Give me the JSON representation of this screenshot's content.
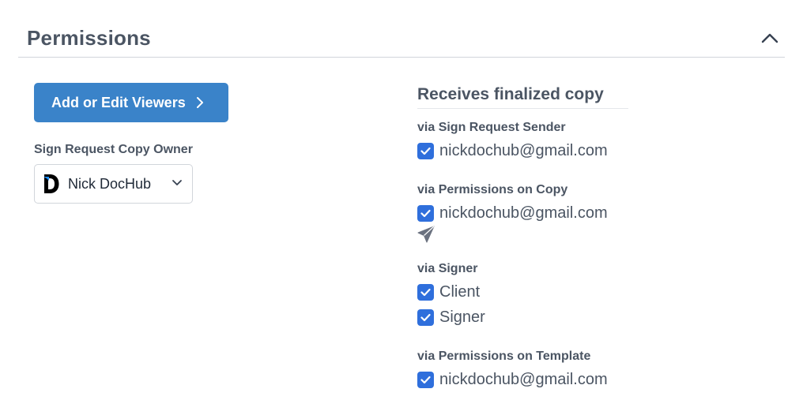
{
  "section": {
    "title": "Permissions",
    "collapse_icon": "chevron-up-icon"
  },
  "viewers": {
    "button_label": "Add or Edit Viewers",
    "button_icon": "chevron-right-icon"
  },
  "owner": {
    "label": "Sign Request Copy Owner",
    "selected": "Nick DocHub",
    "logo_icon": "dochub-logo-icon",
    "dropdown_icon": "chevron-down-icon"
  },
  "finalized": {
    "title": "Receives finalized copy",
    "groups": [
      {
        "label": "via Sign Request Sender",
        "items": [
          {
            "text": "nickdochub@gmail.com",
            "checked": true
          }
        ]
      },
      {
        "label": "via Permissions on Copy",
        "items": [
          {
            "text": "nickdochub@gmail.com",
            "checked": true
          }
        ],
        "action_icon": "send-icon"
      },
      {
        "label": "via Signer",
        "items": [
          {
            "text": "Client",
            "checked": true
          },
          {
            "text": "Signer",
            "checked": true
          }
        ]
      },
      {
        "label": "via Permissions on Template",
        "items": [
          {
            "text": "nickdochub@gmail.com",
            "checked": true
          }
        ]
      }
    ]
  },
  "colors": {
    "primary_button": "#3a83c9",
    "checkbox": "#2f6fdc",
    "text": "#4b5563"
  }
}
